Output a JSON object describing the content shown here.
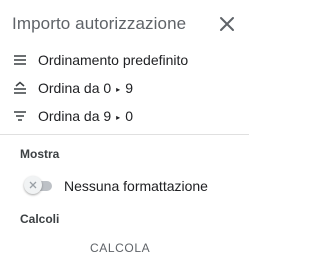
{
  "header": {
    "title": "Importo autorizzazione",
    "close_icon": "close-icon"
  },
  "sort_menu": {
    "items": [
      {
        "icon": "list-icon",
        "label": "Ordinamento predefinito"
      },
      {
        "icon": "sort-ascending-icon",
        "label_from": "Ordina da 0",
        "arrow": "▸",
        "label_to": "9"
      },
      {
        "icon": "sort-descending-icon",
        "label_from": "Ordina da 9",
        "arrow": "▸",
        "label_to": "0"
      }
    ]
  },
  "show_section": {
    "label": "Mostra",
    "toggle": {
      "label": "Nessuna formattazione",
      "checked": false
    }
  },
  "calc_section": {
    "label": "Calcoli",
    "button_label": "CALCOLA"
  }
}
